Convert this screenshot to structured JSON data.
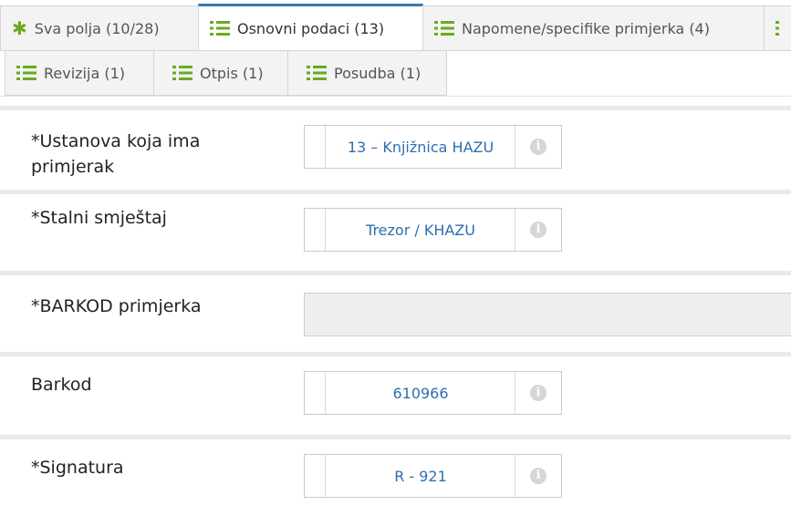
{
  "tabs": [
    {
      "label": "Sva polja (10/28)",
      "icon": "asterisk-icon",
      "active": false
    },
    {
      "label": "Osnovni podaci (13)",
      "icon": "list-icon",
      "active": true
    },
    {
      "label": "Napomene/specifike primjerka (4)",
      "icon": "list-icon",
      "active": false
    },
    {
      "label": "Revizija (1)",
      "icon": "list-icon",
      "active": false
    },
    {
      "label": "Otpis (1)",
      "icon": "list-icon",
      "active": false
    },
    {
      "label": "Posudba (1)",
      "icon": "list-icon",
      "active": false
    }
  ],
  "fields": [
    {
      "label": "*Ustanova koja ima primjerak",
      "value": "13 – Knjižnica HAZU",
      "info_icon": "info-icon"
    },
    {
      "label": "*Stalni smještaj",
      "value": "Trezor / KHAZU",
      "info_icon": "info-icon"
    },
    {
      "label": "*BARKOD primjerka",
      "value": ""
    },
    {
      "label": "Barkod",
      "value": "610966",
      "info_icon": "info-icon"
    },
    {
      "label": "*Signatura",
      "value": "R - 921",
      "info_icon": "info-icon"
    }
  ],
  "colors": {
    "accent": "#337ab7",
    "icon_green": "#6aaa1e",
    "value_text": "#2f6eb0"
  }
}
